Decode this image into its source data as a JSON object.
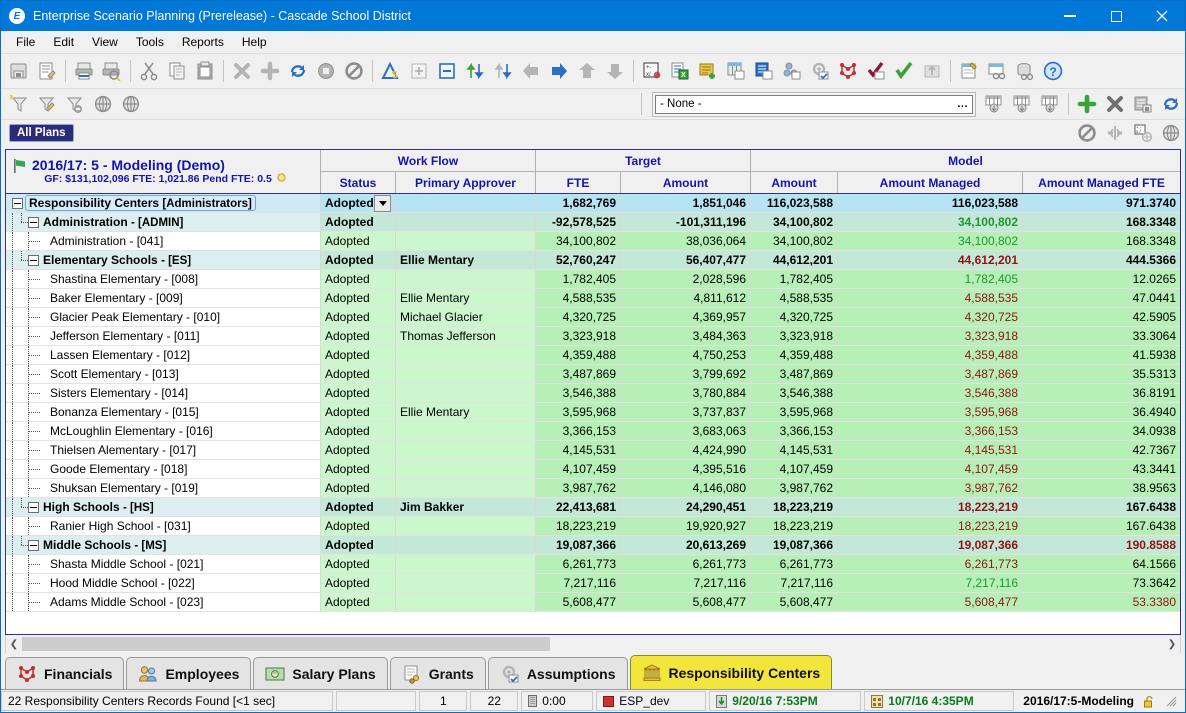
{
  "window": {
    "title": "Enterprise Scenario Planning (Prerelease) - Cascade School District",
    "app_icon": "E",
    "minimize_label": "Minimize",
    "maximize_label": "Maximize",
    "close_label": "Close"
  },
  "menu": [
    "File",
    "Edit",
    "View",
    "Tools",
    "Reports",
    "Help"
  ],
  "toolbar_main": [
    {
      "name": "save-icon",
      "tip": "Save"
    },
    {
      "name": "edit-record-icon",
      "tip": "Edit"
    },
    {
      "sep": true
    },
    {
      "name": "print-icon",
      "tip": "Print"
    },
    {
      "name": "print-preview-icon",
      "tip": "Print Preview"
    },
    {
      "sep": true
    },
    {
      "name": "cut-icon",
      "tip": "Cut"
    },
    {
      "name": "copy-icon",
      "tip": "Copy"
    },
    {
      "name": "paste-icon",
      "tip": "Paste"
    },
    {
      "sep": true
    },
    {
      "name": "delete-icon",
      "tip": "Delete"
    },
    {
      "name": "add-icon",
      "tip": "Add"
    },
    {
      "name": "refresh-icon",
      "tip": "Refresh"
    },
    {
      "name": "recalculate-icon",
      "tip": "Recalculate"
    },
    {
      "name": "cancel-icon",
      "tip": "Cancel"
    },
    {
      "sep": true
    },
    {
      "name": "currency-delta-icon",
      "tip": "Change Amount"
    },
    {
      "name": "expand-all-icon",
      "tip": "Expand All"
    },
    {
      "name": "collapse-all-icon",
      "tip": "Collapse All"
    },
    {
      "name": "sort-up-down-icon",
      "tip": "Sort Ascending"
    },
    {
      "name": "sort-down-icon",
      "tip": "Sort Descending"
    },
    {
      "name": "nav-back-icon",
      "tip": "Back"
    },
    {
      "name": "nav-forward-icon",
      "tip": "Forward"
    },
    {
      "name": "nav-up-icon",
      "tip": "Up"
    },
    {
      "name": "nav-down-icon",
      "tip": "Down"
    },
    {
      "sep": true
    },
    {
      "name": "calculator-icon",
      "tip": "Calculator"
    },
    {
      "name": "export-excel-icon",
      "tip": "Export to Excel"
    },
    {
      "name": "new-note-icon",
      "tip": "New Note"
    },
    {
      "name": "new-worksheet-icon",
      "tip": "New Worksheet"
    },
    {
      "name": "new-report-icon",
      "tip": "New Report"
    },
    {
      "name": "new-org-icon",
      "tip": "New Organization"
    },
    {
      "name": "new-settings-icon",
      "tip": "New Settings"
    },
    {
      "name": "new-scenario-icon",
      "tip": "New Scenario"
    },
    {
      "name": "approve-dark-icon",
      "tip": "Approve"
    },
    {
      "name": "approve-icon",
      "tip": "Approve All"
    },
    {
      "name": "upload-icon",
      "tip": "Upload"
    },
    {
      "sep": true
    },
    {
      "name": "new-query-icon",
      "tip": "New Query"
    },
    {
      "name": "find-table-icon",
      "tip": "Find in Table"
    },
    {
      "name": "find-database-icon",
      "tip": "Find in Database"
    },
    {
      "name": "help-icon",
      "tip": "Help"
    }
  ],
  "toolbar_filter": [
    {
      "name": "new-filter-icon",
      "tip": "New Filter"
    },
    {
      "name": "edit-filter-icon",
      "tip": "Edit Filter"
    },
    {
      "name": "remove-filter-icon",
      "tip": "Remove Filter"
    },
    {
      "name": "globe-filter-icon",
      "tip": "Global Filter"
    },
    {
      "name": "globe-filter-alt-icon",
      "tip": "Global Filter Alt"
    }
  ],
  "toolbar_filter_right": [
    {
      "name": "grid-down-1-icon",
      "tip": "Grid Down 1"
    },
    {
      "name": "grid-down-2-icon",
      "tip": "Grid Down 2"
    },
    {
      "name": "grid-down-3-icon",
      "tip": "Grid Down 3"
    },
    {
      "sep": true
    },
    {
      "name": "add-green-icon",
      "tip": "Add"
    },
    {
      "name": "delete-gray-icon",
      "tip": "Delete"
    },
    {
      "name": "save-db-icon",
      "tip": "Save to Database"
    },
    {
      "name": "refresh-blue-icon",
      "tip": "Refresh"
    }
  ],
  "toolbar_plan_right": [
    {
      "name": "cancel-round-icon",
      "tip": "Cancel"
    },
    {
      "name": "merge-icon",
      "tip": "Merge"
    },
    {
      "name": "calc-grid-icon",
      "tip": "Calculate Grid"
    },
    {
      "name": "globe-plan-icon",
      "tip": "Global"
    }
  ],
  "scenario_select": {
    "value": "- None -",
    "browse_label": "..."
  },
  "plans_button": {
    "label": "All Plans"
  },
  "grid": {
    "corner": {
      "title": "2016/17: 5 - Modeling  (Demo)",
      "subtitle": "GF: $131,102,096  FTE: 1,021.86  Pend FTE: 0.5"
    },
    "groups": [
      {
        "label": "Work Flow",
        "span": "workflow"
      },
      {
        "label": "Target",
        "span": "target"
      },
      {
        "label": "Model",
        "span": "model"
      }
    ],
    "columns": [
      {
        "key": "tree",
        "label": ""
      },
      {
        "key": "status",
        "label": "Status"
      },
      {
        "key": "approver",
        "label": "Primary Approver"
      },
      {
        "key": "target_fte",
        "label": "FTE"
      },
      {
        "key": "target_amount",
        "label": "Amount"
      },
      {
        "key": "model_amount",
        "label": "Amount"
      },
      {
        "key": "model_amount_managed",
        "label": "Amount Managed"
      },
      {
        "key": "model_amount_managed_fte",
        "label": "Amount Managed FTE"
      }
    ],
    "rows": [
      {
        "level": 0,
        "expander": "minus",
        "selected": true,
        "name": "Responsibility Centers",
        "code": "[Administrators]",
        "status": "Adopted",
        "has_dropdown": true,
        "approver": "",
        "target_fte": "1,682,769",
        "target_amount": "1,851,046",
        "model_amount": "116,023,588",
        "model_amount_managed": "116,023,588",
        "managed_color": "black",
        "model_amount_managed_fte": "971.3740",
        "fte_color": "black"
      },
      {
        "level": 1,
        "expander": "minus",
        "name": "Administration",
        "code": "- [ADMIN]",
        "status": "Adopted",
        "approver": "",
        "target_fte": "-92,578,525",
        "target_amount": "-101,311,196",
        "model_amount": "34,100,802",
        "model_amount_managed": "34,100,802",
        "managed_color": "green",
        "model_amount_managed_fte": "168.3348",
        "fte_color": "black"
      },
      {
        "level": 2,
        "name": "Administration",
        "code": "- [041]",
        "status": "Adopted",
        "approver": "",
        "target_fte": "34,100,802",
        "target_amount": "38,036,064",
        "model_amount": "34,100,802",
        "model_amount_managed": "34,100,802",
        "managed_color": "green",
        "model_amount_managed_fte": "168.3348",
        "fte_color": "black"
      },
      {
        "level": 1,
        "expander": "minus",
        "name": "Elementary Schools",
        "code": "- [ES]",
        "status": "Adopted",
        "approver": "Ellie Mentary",
        "target_fte": "52,760,247",
        "target_amount": "56,407,477",
        "model_amount": "44,612,201",
        "model_amount_managed": "44,612,201",
        "managed_color": "red",
        "model_amount_managed_fte": "444.5366",
        "fte_color": "black"
      },
      {
        "level": 2,
        "name": "Shastina Elementary",
        "code": "- [008]",
        "status": "Adopted",
        "approver": "",
        "target_fte": "1,782,405",
        "target_amount": "2,028,596",
        "model_amount": "1,782,405",
        "model_amount_managed": "1,782,405",
        "managed_color": "green",
        "model_amount_managed_fte": "12.0265",
        "fte_color": "black"
      },
      {
        "level": 2,
        "name": "Baker Elementary",
        "code": "- [009]",
        "status": "Adopted",
        "approver": "Ellie Mentary",
        "target_fte": "4,588,535",
        "target_amount": "4,811,612",
        "model_amount": "4,588,535",
        "model_amount_managed": "4,588,535",
        "managed_color": "red",
        "model_amount_managed_fte": "47.0441",
        "fte_color": "black"
      },
      {
        "level": 2,
        "name": "Glacier Peak Elementary",
        "code": "- [010]",
        "status": "Adopted",
        "approver": "Michael Glacier",
        "target_fte": "4,320,725",
        "target_amount": "4,369,957",
        "model_amount": "4,320,725",
        "model_amount_managed": "4,320,725",
        "managed_color": "red",
        "model_amount_managed_fte": "42.5905",
        "fte_color": "black"
      },
      {
        "level": 2,
        "name": "Jefferson Elementary",
        "code": "- [011]",
        "status": "Adopted",
        "approver": "Thomas Jefferson",
        "target_fte": "3,323,918",
        "target_amount": "3,484,363",
        "model_amount": "3,323,918",
        "model_amount_managed": "3,323,918",
        "managed_color": "red",
        "model_amount_managed_fte": "33.3064",
        "fte_color": "black"
      },
      {
        "level": 2,
        "name": "Lassen Elementary",
        "code": "- [012]",
        "status": "Adopted",
        "approver": "",
        "target_fte": "4,359,488",
        "target_amount": "4,750,253",
        "model_amount": "4,359,488",
        "model_amount_managed": "4,359,488",
        "managed_color": "red",
        "model_amount_managed_fte": "41.5938",
        "fte_color": "black"
      },
      {
        "level": 2,
        "name": "Scott Elementary",
        "code": "- [013]",
        "status": "Adopted",
        "approver": "",
        "target_fte": "3,487,869",
        "target_amount": "3,799,692",
        "model_amount": "3,487,869",
        "model_amount_managed": "3,487,869",
        "managed_color": "red",
        "model_amount_managed_fte": "35.5313",
        "fte_color": "black"
      },
      {
        "level": 2,
        "name": "Sisters Elementary",
        "code": "- [014]",
        "status": "Adopted",
        "approver": "",
        "target_fte": "3,546,388",
        "target_amount": "3,780,884",
        "model_amount": "3,546,388",
        "model_amount_managed": "3,546,388",
        "managed_color": "red",
        "model_amount_managed_fte": "36.8191",
        "fte_color": "black"
      },
      {
        "level": 2,
        "name": "Bonanza Elementary",
        "code": "- [015]",
        "status": "Adopted",
        "approver": "Ellie Mentary",
        "target_fte": "3,595,968",
        "target_amount": "3,737,837",
        "model_amount": "3,595,968",
        "model_amount_managed": "3,595,968",
        "managed_color": "red",
        "model_amount_managed_fte": "36.4940",
        "fte_color": "black"
      },
      {
        "level": 2,
        "name": "McLoughlin Elementary",
        "code": "- [016]",
        "status": "Adopted",
        "approver": "",
        "target_fte": "3,366,153",
        "target_amount": "3,683,063",
        "model_amount": "3,366,153",
        "model_amount_managed": "3,366,153",
        "managed_color": "red",
        "model_amount_managed_fte": "34.0938",
        "fte_color": "black"
      },
      {
        "level": 2,
        "name": "Thielsen Alementary",
        "code": "- [017]",
        "status": "Adopted",
        "approver": "",
        "target_fte": "4,145,531",
        "target_amount": "4,424,990",
        "model_amount": "4,145,531",
        "model_amount_managed": "4,145,531",
        "managed_color": "red",
        "model_amount_managed_fte": "42.7367",
        "fte_color": "black"
      },
      {
        "level": 2,
        "name": "Goode Elementary",
        "code": "- [018]",
        "status": "Adopted",
        "approver": "",
        "target_fte": "4,107,459",
        "target_amount": "4,395,516",
        "model_amount": "4,107,459",
        "model_amount_managed": "4,107,459",
        "managed_color": "red",
        "model_amount_managed_fte": "43.3441",
        "fte_color": "black"
      },
      {
        "level": 2,
        "name": "Shuksan Elementary",
        "code": "- [019]",
        "status": "Adopted",
        "approver": "",
        "target_fte": "3,987,762",
        "target_amount": "4,146,080",
        "model_amount": "3,987,762",
        "model_amount_managed": "3,987,762",
        "managed_color": "red",
        "model_amount_managed_fte": "38.9563",
        "fte_color": "black"
      },
      {
        "level": 1,
        "expander": "minus",
        "name": "High Schools",
        "code": "- [HS]",
        "status": "Adopted",
        "approver": "Jim Bakker",
        "target_fte": "22,413,681",
        "target_amount": "24,290,451",
        "model_amount": "18,223,219",
        "model_amount_managed": "18,223,219",
        "managed_color": "red",
        "model_amount_managed_fte": "167.6438",
        "fte_color": "black"
      },
      {
        "level": 2,
        "name": "Ranier High School",
        "code": "- [031]",
        "status": "Adopted",
        "approver": "",
        "target_fte": "18,223,219",
        "target_amount": "19,920,927",
        "model_amount": "18,223,219",
        "model_amount_managed": "18,223,219",
        "managed_color": "red",
        "model_amount_managed_fte": "167.6438",
        "fte_color": "black"
      },
      {
        "level": 1,
        "expander": "minus",
        "name": "Middle Schools",
        "code": "- [MS]",
        "status": "Adopted",
        "approver": "",
        "target_fte": "19,087,366",
        "target_amount": "20,613,269",
        "model_amount": "19,087,366",
        "model_amount_managed": "19,087,366",
        "managed_color": "red",
        "model_amount_managed_fte": "190.8588",
        "fte_color": "red"
      },
      {
        "level": 2,
        "name": "Shasta Middle School",
        "code": "- [021]",
        "status": "Adopted",
        "approver": "",
        "target_fte": "6,261,773",
        "target_amount": "6,261,773",
        "model_amount": "6,261,773",
        "model_amount_managed": "6,261,773",
        "managed_color": "red",
        "model_amount_managed_fte": "64.1566",
        "fte_color": "black"
      },
      {
        "level": 2,
        "name": "Hood Middle School",
        "code": "- [022]",
        "status": "Adopted",
        "approver": "",
        "target_fte": "7,217,116",
        "target_amount": "7,217,116",
        "model_amount": "7,217,116",
        "model_amount_managed": "7,217,116",
        "managed_color": "green",
        "model_amount_managed_fte": "73.3642",
        "fte_color": "black"
      },
      {
        "level": 2,
        "name": "Adams Middle School",
        "code": "- [023]",
        "status": "Adopted",
        "approver": "",
        "target_fte": "5,608,477",
        "target_amount": "5,608,477",
        "model_amount": "5,608,477",
        "model_amount_managed": "5,608,477",
        "managed_color": "red",
        "model_amount_managed_fte": "53.3380",
        "fte_color": "red"
      }
    ]
  },
  "tabs": [
    {
      "label": "Financials",
      "icon": "financials-icon",
      "active": false
    },
    {
      "label": "Employees",
      "icon": "employees-icon",
      "active": false
    },
    {
      "label": "Salary Plans",
      "icon": "salary-plans-icon",
      "active": false
    },
    {
      "label": "Grants",
      "icon": "grants-icon",
      "active": false
    },
    {
      "label": "Assumptions",
      "icon": "assumptions-icon",
      "active": false
    },
    {
      "label": "Responsibility Centers",
      "icon": "responsibility-centers-icon",
      "active": true
    }
  ],
  "statusbar": {
    "message": "22 Responsibility Centers Records Found [<1 sec]",
    "blank_panel": "",
    "page": "1",
    "record_count": "22",
    "elapsed": "0:00",
    "database": "ESP_dev",
    "loaded_date": "9/20/16 7:53PM",
    "modified_date": "10/7/16 4:35PM",
    "plan": "2016/17:5-Modeling"
  },
  "colors": {
    "accent": "#0078d7",
    "header_text": "#1414b0",
    "positive": "#1a9a2a",
    "negative": "#8f1414",
    "active_tab": "#f2e53c"
  }
}
